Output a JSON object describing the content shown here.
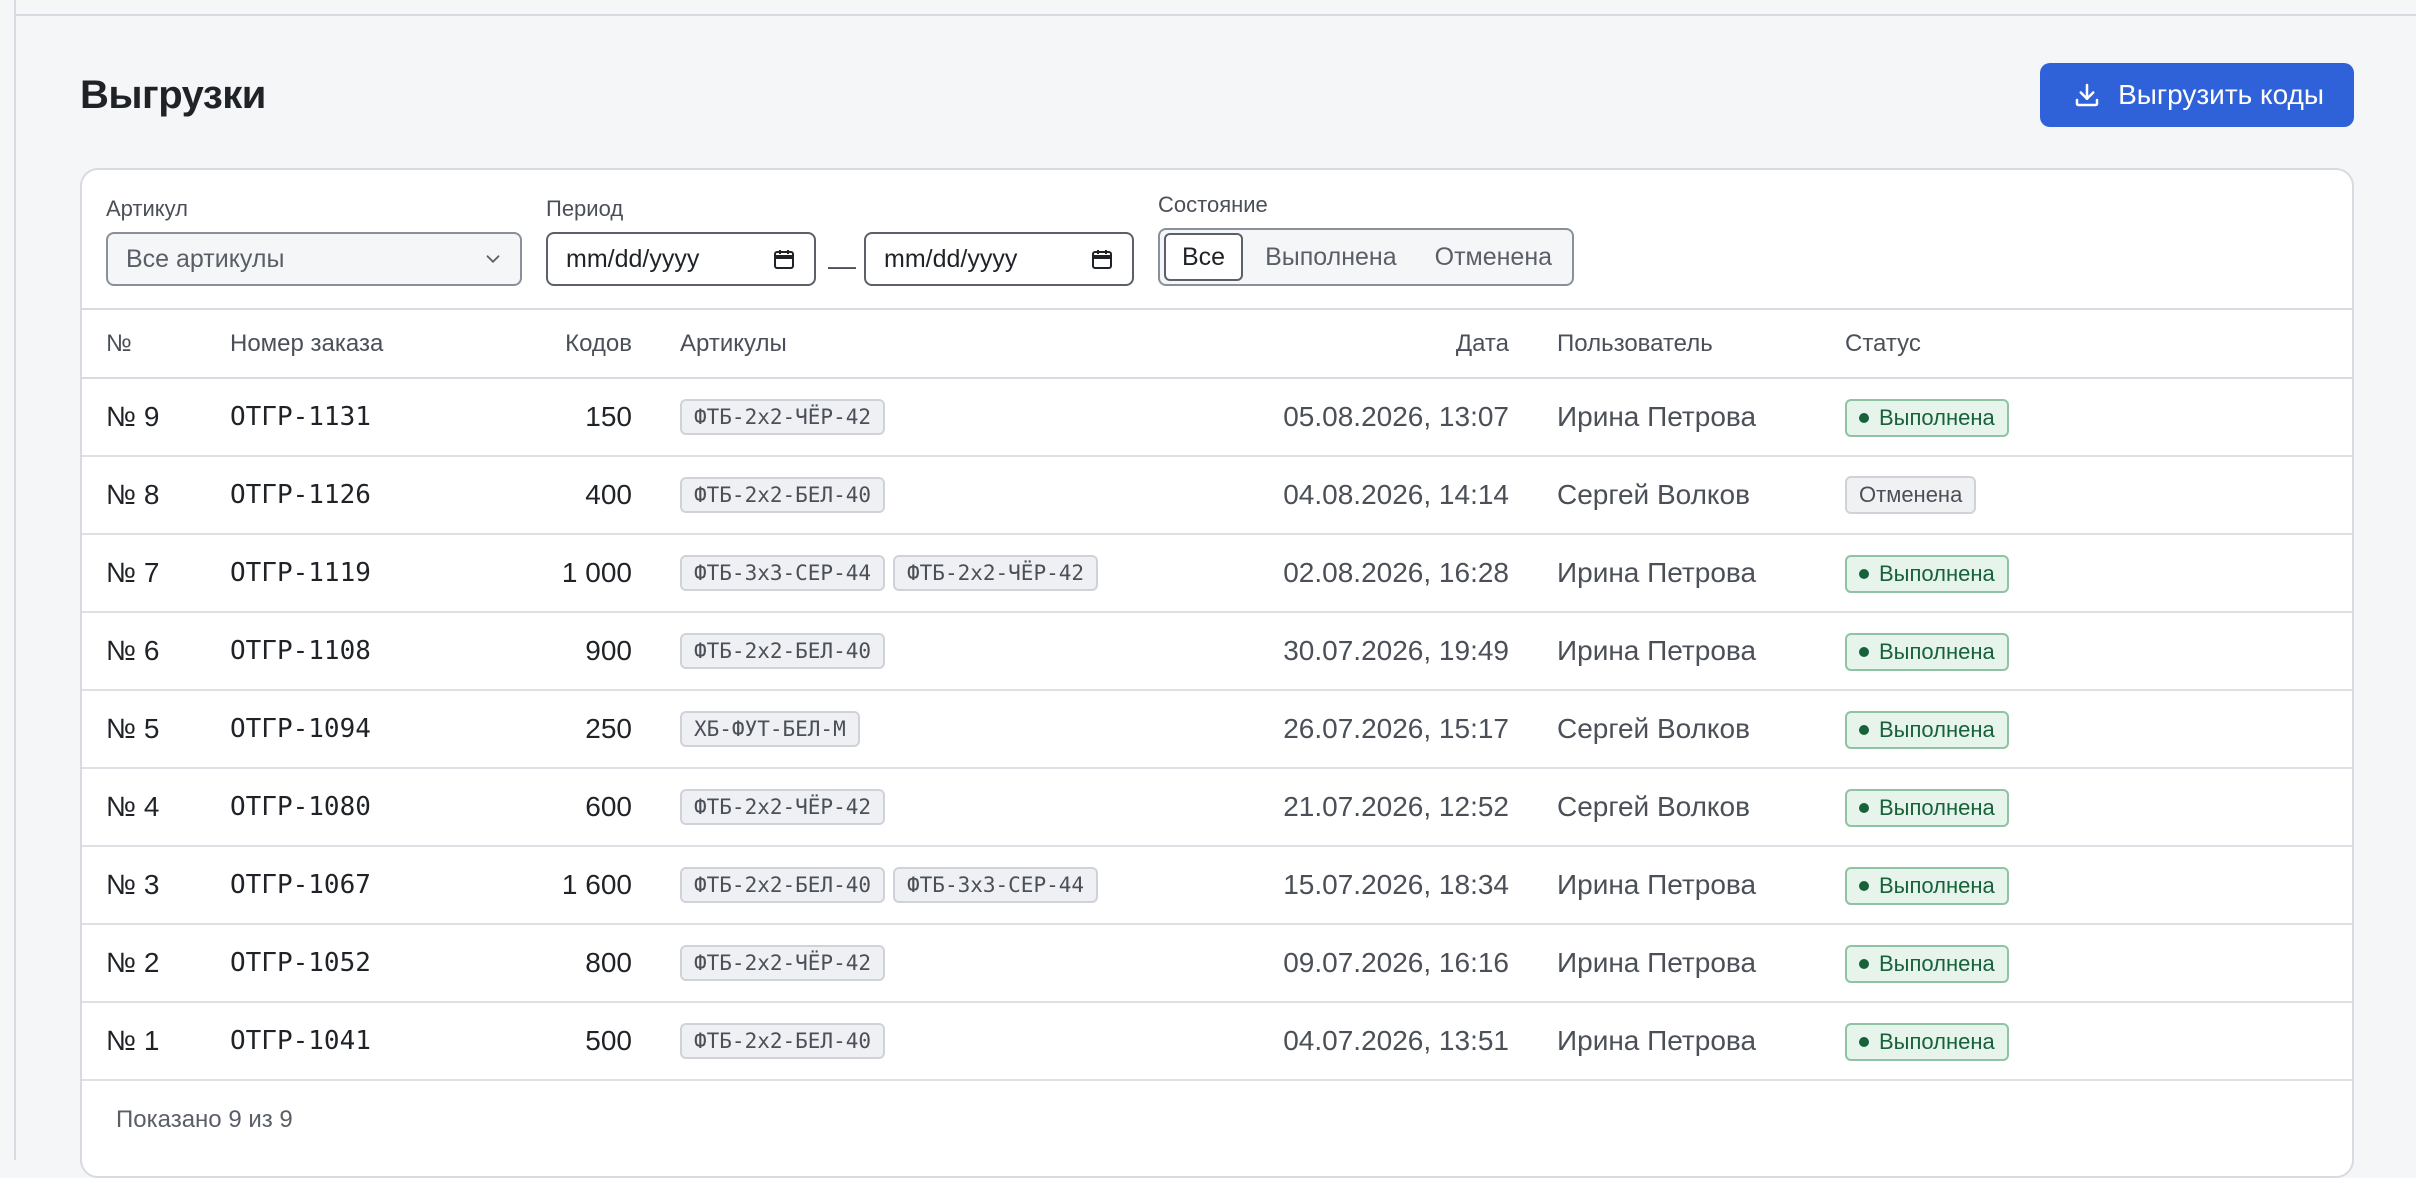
{
  "page": {
    "title": "Выгрузки",
    "export_button_label": "Выгрузить коды"
  },
  "filters": {
    "article_label": "Артикул",
    "article_value": "Все артикулы",
    "period_label": "Период",
    "date_from_placeholder": "mm/dd/yyyy",
    "date_to_placeholder": "mm/dd/yyyy",
    "period_separator": "—",
    "state_label": "Состояние",
    "state_options": [
      "Все",
      "Выполнена",
      "Отменена"
    ],
    "state_selected": "Все"
  },
  "table": {
    "columns": [
      "№",
      "Номер заказа",
      "Кодов",
      "Артикулы",
      "Дата",
      "Пользователь",
      "Статус"
    ],
    "rows": [
      {
        "num": "№ 9",
        "order": "ОТГР-1131",
        "codes": "150",
        "articles": [
          "ФТБ-2х2-ЧЁР-42"
        ],
        "date": "05.08.2026, 13:07",
        "user": "Ирина Петрова",
        "status": "Выполнена",
        "status_kind": "ok"
      },
      {
        "num": "№ 8",
        "order": "ОТГР-1126",
        "codes": "400",
        "articles": [
          "ФТБ-2х2-БЕЛ-40"
        ],
        "date": "04.08.2026, 14:14",
        "user": "Сергей Волков",
        "status": "Отменена",
        "status_kind": "cancel"
      },
      {
        "num": "№ 7",
        "order": "ОТГР-1119",
        "codes": "1 000",
        "articles": [
          "ФТБ-3х3-СЕР-44",
          "ФТБ-2х2-ЧЁР-42"
        ],
        "date": "02.08.2026, 16:28",
        "user": "Ирина Петрова",
        "status": "Выполнена",
        "status_kind": "ok"
      },
      {
        "num": "№ 6",
        "order": "ОТГР-1108",
        "codes": "900",
        "articles": [
          "ФТБ-2х2-БЕЛ-40"
        ],
        "date": "30.07.2026, 19:49",
        "user": "Ирина Петрова",
        "status": "Выполнена",
        "status_kind": "ok"
      },
      {
        "num": "№ 5",
        "order": "ОТГР-1094",
        "codes": "250",
        "articles": [
          "ХБ-ФУТ-БЕЛ-М"
        ],
        "date": "26.07.2026, 15:17",
        "user": "Сергей Волков",
        "status": "Выполнена",
        "status_kind": "ok"
      },
      {
        "num": "№ 4",
        "order": "ОТГР-1080",
        "codes": "600",
        "articles": [
          "ФТБ-2х2-ЧЁР-42"
        ],
        "date": "21.07.2026, 12:52",
        "user": "Сергей Волков",
        "status": "Выполнена",
        "status_kind": "ok"
      },
      {
        "num": "№ 3",
        "order": "ОТГР-1067",
        "codes": "1 600",
        "articles": [
          "ФТБ-2х2-БЕЛ-40",
          "ФТБ-3х3-СЕР-44"
        ],
        "date": "15.07.2026, 18:34",
        "user": "Ирина Петрова",
        "status": "Выполнена",
        "status_kind": "ok"
      },
      {
        "num": "№ 2",
        "order": "ОТГР-1052",
        "codes": "800",
        "articles": [
          "ФТБ-2х2-ЧЁР-42"
        ],
        "date": "09.07.2026, 16:16",
        "user": "Ирина Петрова",
        "status": "Выполнена",
        "status_kind": "ok"
      },
      {
        "num": "№ 1",
        "order": "ОТГР-1041",
        "codes": "500",
        "articles": [
          "ФТБ-2х2-БЕЛ-40"
        ],
        "date": "04.07.2026, 13:51",
        "user": "Ирина Петрова",
        "status": "Выполнена",
        "status_kind": "ok"
      }
    ]
  },
  "footer": {
    "shown_text": "Показано 9 из 9"
  },
  "colors": {
    "accent": "#2f62d9",
    "success": "#17623a",
    "success_bg": "#e6f4ec"
  }
}
